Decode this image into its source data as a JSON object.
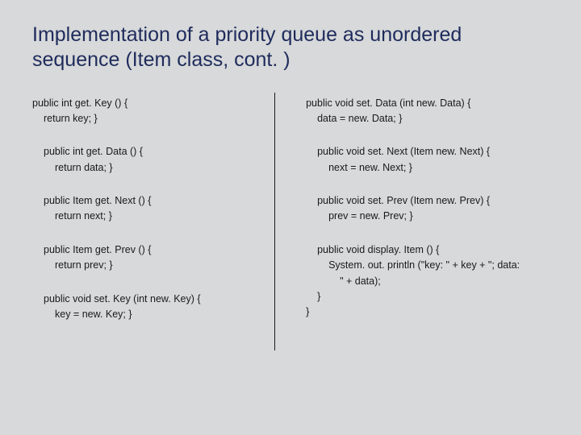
{
  "title": "Implementation of a priority queue as unordered sequence (Item class, cont. )",
  "left": {
    "b1": {
      "l1": "public int get. Key () {",
      "l2": "return key;  }"
    },
    "b2": {
      "l1": "public int get. Data () {",
      "l2": "return data;  }"
    },
    "b3": {
      "l1": "public Item get. Next () {",
      "l2": "return next;  }"
    },
    "b4": {
      "l1": "public Item get. Prev () {",
      "l2": "return prev;  }"
    },
    "b5": {
      "l1": "public void set. Key (int new. Key) {",
      "l2": "key = new. Key;  }"
    }
  },
  "right": {
    "b1": {
      "l1": "public void set. Data (int new. Data) {",
      "l2": "data = new. Data;  }"
    },
    "b2": {
      "l1": "public void set. Next (Item new. Next) {",
      "l2": "next = new. Next;  }"
    },
    "b3": {
      "l1": "public void set. Prev (Item new. Prev) {",
      "l2": "prev = new. Prev;  }"
    },
    "b4": {
      "l1": "public void display. Item () {",
      "l2": "System. out. println (\"key: \" + key + \";  data:",
      "l3": "\" + data);",
      "l4": "}",
      "l5": "}"
    }
  }
}
